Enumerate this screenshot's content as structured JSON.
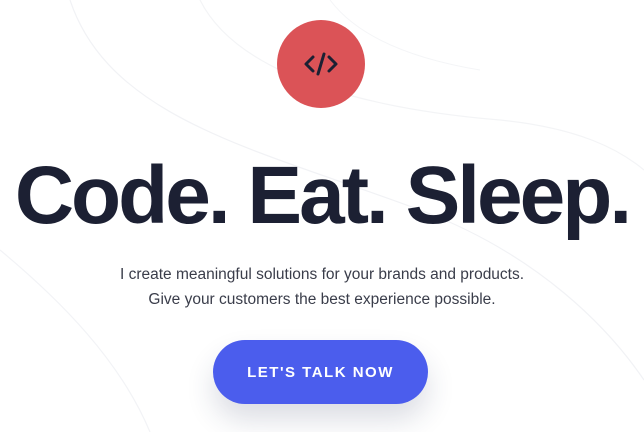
{
  "hero": {
    "logo_icon": "code-brackets-icon",
    "logo_color": "#db5357",
    "headline": "Code. Eat. Sleep.",
    "subtext_line1": "I create meaningful solutions for your brands and products.",
    "subtext_line2": "Give your customers the best experience possible.",
    "cta_label": "LET'S TALK NOW",
    "cta_color": "#4b5ded",
    "headline_color": "#1c2033"
  }
}
